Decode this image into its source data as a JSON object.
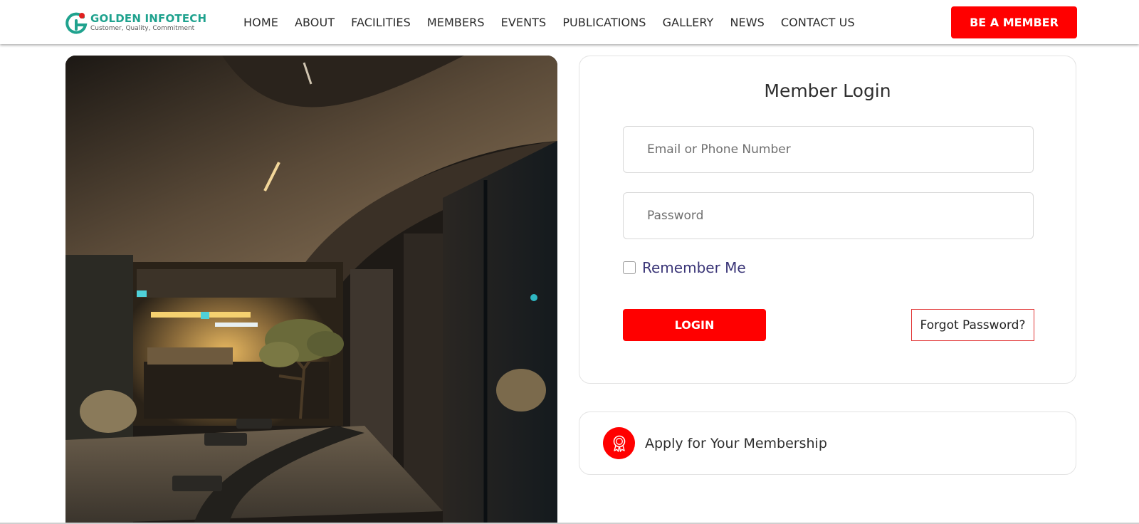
{
  "brand": {
    "name": "GOLDEN INFOTECH",
    "tagline": "Customer, Quality, Commitment",
    "colors": {
      "teal": "#1fa28e",
      "red": "#ff0000"
    }
  },
  "nav": {
    "items": [
      "HOME",
      "ABOUT",
      "FACILITIES",
      "MEMBERS",
      "EVENTS",
      "PUBLICATIONS",
      "GALLERY",
      "NEWS",
      "CONTACT US"
    ],
    "cta_label": "BE A MEMBER"
  },
  "hero": {
    "icon": "interior-photo"
  },
  "login": {
    "title": "Member Login",
    "email_placeholder": "Email or Phone Number",
    "password_placeholder": "Password",
    "remember_label": "Remember Me",
    "login_label": "LOGIN",
    "forgot_label": "Forgot Password?"
  },
  "apply": {
    "label": "Apply for Your Membership",
    "icon": "award-badge-icon"
  }
}
